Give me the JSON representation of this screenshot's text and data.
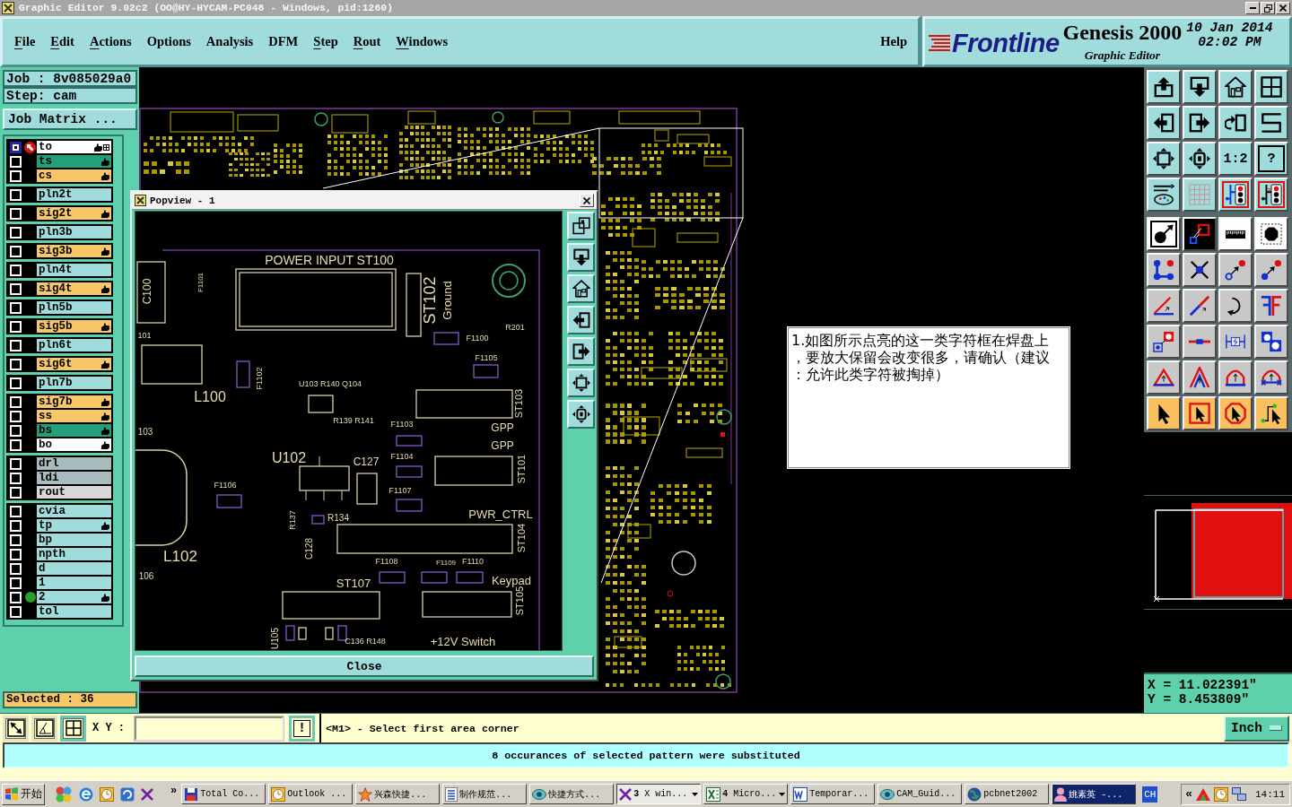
{
  "window": {
    "title": "Graphic Editor 9.02c2 (OO@HY-HYCAM-PC048 - Windows, pid:1260)"
  },
  "menu": [
    {
      "label": "File",
      "mnemonic": true
    },
    {
      "label": "Edit",
      "mnemonic": true
    },
    {
      "label": "Actions",
      "mnemonic": true
    },
    {
      "label": "Options",
      "mnemonic": false
    },
    {
      "label": "Analysis",
      "mnemonic": false
    },
    {
      "label": "DFM",
      "mnemonic": false
    },
    {
      "label": "Step",
      "mnemonic": true
    },
    {
      "label": "Rout",
      "mnemonic": true
    },
    {
      "label": "Windows",
      "mnemonic": true
    }
  ],
  "help_menu": {
    "label": "Help",
    "mnemonic": false
  },
  "brand": {
    "logo": "Frontline",
    "product": "Genesis 2000",
    "subtitle": "Graphic Editor",
    "date": "10 Jan 2014",
    "time": "02:02 PM"
  },
  "job": {
    "job": "Job : 8v085029a0",
    "step": "Step: cam",
    "matrix_button": "Job Matrix ..."
  },
  "layer_groups": [
    {
      "layers": [
        {
          "name": "to",
          "color": "#ffffff",
          "displayed": true,
          "work_layer": true,
          "affected": true,
          "has_selection": true,
          "marked": false
        },
        {
          "name": "ts",
          "color": "#22a07c",
          "displayed": false,
          "work_layer": false,
          "affected": true,
          "has_selection": false,
          "marked": false
        },
        {
          "name": "cs",
          "color": "#f8c868",
          "displayed": false,
          "work_layer": false,
          "affected": true,
          "has_selection": false,
          "marked": false
        }
      ]
    },
    {
      "layers": [
        {
          "name": "pln2t",
          "color": "#a0dcdc",
          "displayed": false,
          "work_layer": false,
          "affected": false,
          "has_selection": false,
          "marked": false
        }
      ]
    },
    {
      "layers": [
        {
          "name": "sig2t",
          "color": "#f8c868",
          "displayed": false,
          "work_layer": false,
          "affected": true,
          "has_selection": false,
          "marked": false
        }
      ]
    },
    {
      "layers": [
        {
          "name": "pln3b",
          "color": "#a0dcdc",
          "displayed": false,
          "work_layer": false,
          "affected": false,
          "has_selection": false,
          "marked": false
        }
      ]
    },
    {
      "layers": [
        {
          "name": "sig3b",
          "color": "#f8c868",
          "displayed": false,
          "work_layer": false,
          "affected": true,
          "has_selection": false,
          "marked": false
        }
      ]
    },
    {
      "layers": [
        {
          "name": "pln4t",
          "color": "#a0dcdc",
          "displayed": false,
          "work_layer": false,
          "affected": false,
          "has_selection": false,
          "marked": false
        }
      ]
    },
    {
      "layers": [
        {
          "name": "sig4t",
          "color": "#f8c868",
          "displayed": false,
          "work_layer": false,
          "affected": true,
          "has_selection": false,
          "marked": false
        }
      ]
    },
    {
      "layers": [
        {
          "name": "pln5b",
          "color": "#a0dcdc",
          "displayed": false,
          "work_layer": false,
          "affected": false,
          "has_selection": false,
          "marked": false
        }
      ]
    },
    {
      "layers": [
        {
          "name": "sig5b",
          "color": "#f8c868",
          "displayed": false,
          "work_layer": false,
          "affected": true,
          "has_selection": false,
          "marked": false
        }
      ]
    },
    {
      "layers": [
        {
          "name": "pln6t",
          "color": "#a0dcdc",
          "displayed": false,
          "work_layer": false,
          "affected": false,
          "has_selection": false,
          "marked": false
        }
      ]
    },
    {
      "layers": [
        {
          "name": "sig6t",
          "color": "#f8c868",
          "displayed": false,
          "work_layer": false,
          "affected": true,
          "has_selection": false,
          "marked": false
        }
      ]
    },
    {
      "layers": [
        {
          "name": "pln7b",
          "color": "#a0dcdc",
          "displayed": false,
          "work_layer": false,
          "affected": false,
          "has_selection": false,
          "marked": false
        }
      ]
    },
    {
      "layers": [
        {
          "name": "sig7b",
          "color": "#f8c868",
          "displayed": false,
          "work_layer": false,
          "affected": true,
          "has_selection": false,
          "marked": false
        },
        {
          "name": "ss",
          "color": "#f8c868",
          "displayed": false,
          "work_layer": false,
          "affected": true,
          "has_selection": false,
          "marked": false
        },
        {
          "name": "bs",
          "color": "#22a07c",
          "displayed": false,
          "work_layer": false,
          "affected": true,
          "has_selection": false,
          "marked": false
        },
        {
          "name": "bo",
          "color": "#ffffff",
          "displayed": false,
          "work_layer": false,
          "affected": true,
          "has_selection": false,
          "marked": false
        }
      ]
    },
    {
      "layers": [
        {
          "name": "drl",
          "color": "#a8bcc0",
          "displayed": false,
          "work_layer": false,
          "affected": false,
          "has_selection": false,
          "marked": false
        },
        {
          "name": "ldi",
          "color": "#a8bcc0",
          "displayed": false,
          "work_layer": false,
          "affected": false,
          "has_selection": false,
          "marked": false
        },
        {
          "name": "rout",
          "color": "#d8d8d8",
          "displayed": false,
          "work_layer": false,
          "affected": false,
          "has_selection": false,
          "marked": false
        }
      ]
    },
    {
      "layers": [
        {
          "name": "cvia",
          "color": "#a0dcdc",
          "displayed": false,
          "work_layer": false,
          "affected": false,
          "has_selection": false,
          "marked": false
        },
        {
          "name": "tp",
          "color": "#a0dcdc",
          "displayed": false,
          "work_layer": false,
          "affected": true,
          "has_selection": false,
          "marked": false
        },
        {
          "name": "bp",
          "color": "#a0dcdc",
          "displayed": false,
          "work_layer": false,
          "affected": false,
          "has_selection": false,
          "marked": false
        },
        {
          "name": "npth",
          "color": "#a0dcdc",
          "displayed": false,
          "work_layer": false,
          "affected": false,
          "has_selection": false,
          "marked": false
        },
        {
          "name": "d",
          "color": "#a0dcdc",
          "displayed": false,
          "work_layer": false,
          "affected": false,
          "has_selection": false,
          "marked": false
        },
        {
          "name": "1",
          "color": "#a0dcdc",
          "displayed": false,
          "work_layer": false,
          "affected": false,
          "has_selection": false,
          "marked": false
        },
        {
          "name": "2",
          "color": "#a0dcdc",
          "displayed": false,
          "work_layer": false,
          "affected": true,
          "has_selection": false,
          "marked": true
        },
        {
          "name": "tol",
          "color": "#a0dcdc",
          "displayed": false,
          "work_layer": false,
          "affected": false,
          "has_selection": false,
          "marked": false
        }
      ]
    }
  ],
  "selected_count": "Selected : 36",
  "popview": {
    "title": "Popview - 1",
    "labels": [
      "POWER INPUT ST100",
      "C100",
      "F1101",
      "ST102",
      "Ground",
      "R201",
      "101",
      "F1100",
      "F1105",
      "F1102",
      "L100",
      "U103 R140 Q104",
      "ST103",
      "R139 R141",
      "F1103",
      "GPP",
      "103",
      "GPP",
      "U102",
      "C127",
      "F1104",
      "ST101",
      "F1106",
      "F1107",
      "PWR_CTRL",
      "R137",
      "R134",
      "ST104",
      "C128",
      "L102",
      "F1108",
      "F1109",
      "F1110",
      "106",
      "ST107",
      "Keypad",
      "ST105",
      "U105",
      "C136 R148",
      "+12V Switch"
    ],
    "close_button": "Close"
  },
  "note": "1.如图所示点亮的这一类字符框在焊盘上，要放大保留会改变很多，请确认（建议：允许此类字符被掏掉）",
  "tool_palette": {
    "scale_button": "1:2",
    "help_button": "?"
  },
  "coordinates": {
    "x": "X = 11.022391\"",
    "y": "Y = 8.453809\""
  },
  "command_bar": {
    "toggles": [
      {
        "on": false
      },
      {
        "on": false
      },
      {
        "on": true
      }
    ],
    "xy_label": "X Y :",
    "alert_button": "!",
    "prompt": "<M1> - Select first area corner",
    "units": "Inch"
  },
  "status_message": "8 occurances of selected pattern were substituted",
  "taskbar": {
    "start": "开始",
    "more": "»",
    "tasks": [
      {
        "label": "Total Co...",
        "selected": false,
        "grouped": false,
        "flashing": false
      },
      {
        "label": "Outlook ...",
        "selected": false,
        "grouped": false,
        "flashing": false
      },
      {
        "label": "兴森快捷...",
        "selected": false,
        "grouped": false,
        "flashing": false
      },
      {
        "label": "制作规范...",
        "selected": false,
        "grouped": false,
        "flashing": false
      },
      {
        "label": "快捷方式...",
        "selected": false,
        "grouped": false,
        "flashing": false
      },
      {
        "label": "**3** X win...",
        "selected": true,
        "grouped": true,
        "flashing": false
      },
      {
        "label": "**4** Micro...",
        "selected": false,
        "grouped": true,
        "flashing": false
      },
      {
        "label": "Temporar...",
        "selected": false,
        "grouped": false,
        "flashing": false
      },
      {
        "label": "CAM_Guid...",
        "selected": false,
        "grouped": false,
        "flashing": false
      },
      {
        "label": "pcbnet2002",
        "selected": false,
        "grouped": false,
        "flashing": false
      },
      {
        "label": "姚素英 -...",
        "selected": false,
        "grouped": false,
        "flashing": true
      }
    ],
    "language": "CH",
    "tray_expand": "«",
    "clock": "14:11"
  }
}
